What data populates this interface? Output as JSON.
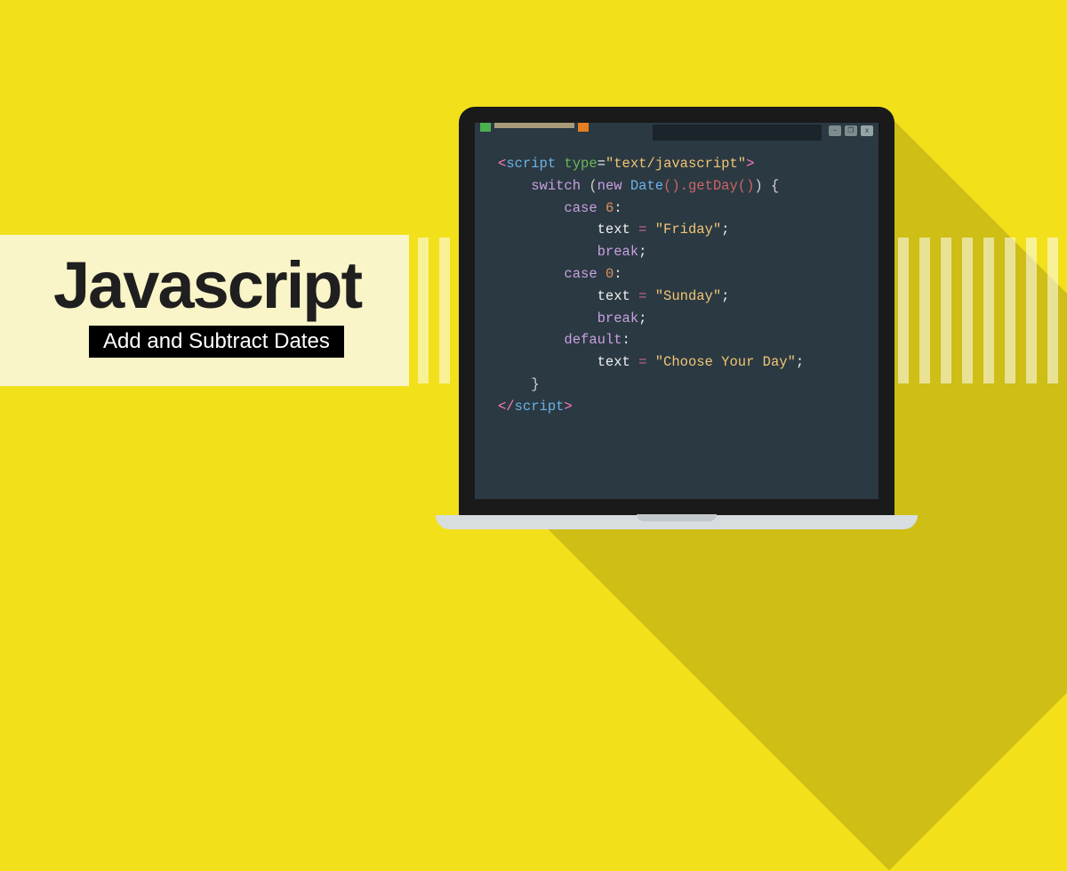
{
  "title": {
    "main": "Javascript",
    "sub": "Add and Subtract Dates"
  },
  "code": {
    "l1_open": "<",
    "l1_tag": "script",
    "l1_attr": " type",
    "l1_eq": "=",
    "l1_str": "\"text/javascript\"",
    "l1_close": ">",
    "l2_switch": "switch",
    "l2_paren": " (",
    "l2_new": "new",
    "l2_date": " Date",
    "l2_call": "().getDay()",
    "l2_brace": ") {",
    "l3_case": "case",
    "l3_val": " 6",
    "l3_colon": ":",
    "l4_var": "text ",
    "l4_eq": "= ",
    "l4_str": "\"Friday\"",
    "l4_semi": ";",
    "l5_break": "break",
    "l5_semi": ";",
    "l6_case": "case",
    "l6_val": " 0",
    "l6_colon": ":",
    "l7_var": "text ",
    "l7_eq": "= ",
    "l7_str": "\"Sunday\"",
    "l7_semi": ";",
    "l8_break": "break",
    "l8_semi": ";",
    "l9_default": "default",
    "l9_colon": ":",
    "l10_var": "text ",
    "l10_eq": "= ",
    "l10_str": "\"Choose Your Day\"",
    "l10_semi": ";",
    "l11_brace": "}",
    "l12_open": "</",
    "l12_tag": "script",
    "l12_close": ">"
  },
  "window": {
    "min": "−",
    "max": "❐",
    "close": "x"
  }
}
